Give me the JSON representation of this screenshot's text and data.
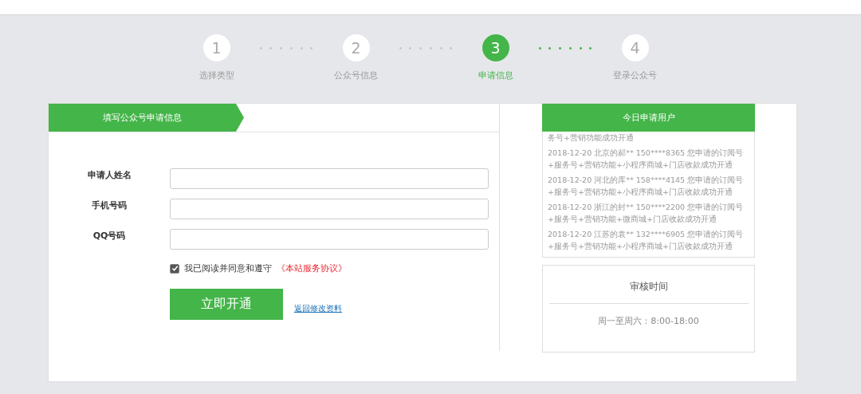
{
  "steps": [
    {
      "number": "1",
      "label": "选择类型",
      "selected": false
    },
    {
      "number": "2",
      "label": "公众号信息",
      "selected": false
    },
    {
      "number": "3",
      "label": "申请信息",
      "selected": true
    },
    {
      "number": "4",
      "label": "登录公众号",
      "selected": false
    }
  ],
  "form": {
    "tab": "填写公众号申请信息",
    "fields": [
      {
        "label": "申请人姓名"
      },
      {
        "label": "手机号码"
      },
      {
        "label": "QQ号码"
      }
    ],
    "agreement": {
      "checked": true,
      "text": "我已阅读并同意和遵守",
      "link": "《本站服务协议》"
    },
    "submit": "立即开通",
    "back_link": "返回修改资料"
  },
  "feed": {
    "title": "今日申请用户",
    "items": [
      "务号+营销功能成功开通",
      "2018-12-20 北京的郝** 150****8365 您申请的订阅号+服务号+营销功能+小程序商城+门店收款成功开通",
      "2018-12-20 河北的库** 158****4145 您申请的订阅号+服务号+营销功能+小程序商城+门店收款成功开通",
      "2018-12-20 浙江的封** 150****2200 您申请的订阅号+服务号+营销功能+微商城+门店收款成功开通",
      "2018-12-20 江苏的袁** 132****6905 您申请的订阅号+服务号+营销功能+小程序商城+门店收款成功开通"
    ]
  },
  "review": {
    "title": "审核时间",
    "hours": "周一至周六：8:00-18:00"
  }
}
